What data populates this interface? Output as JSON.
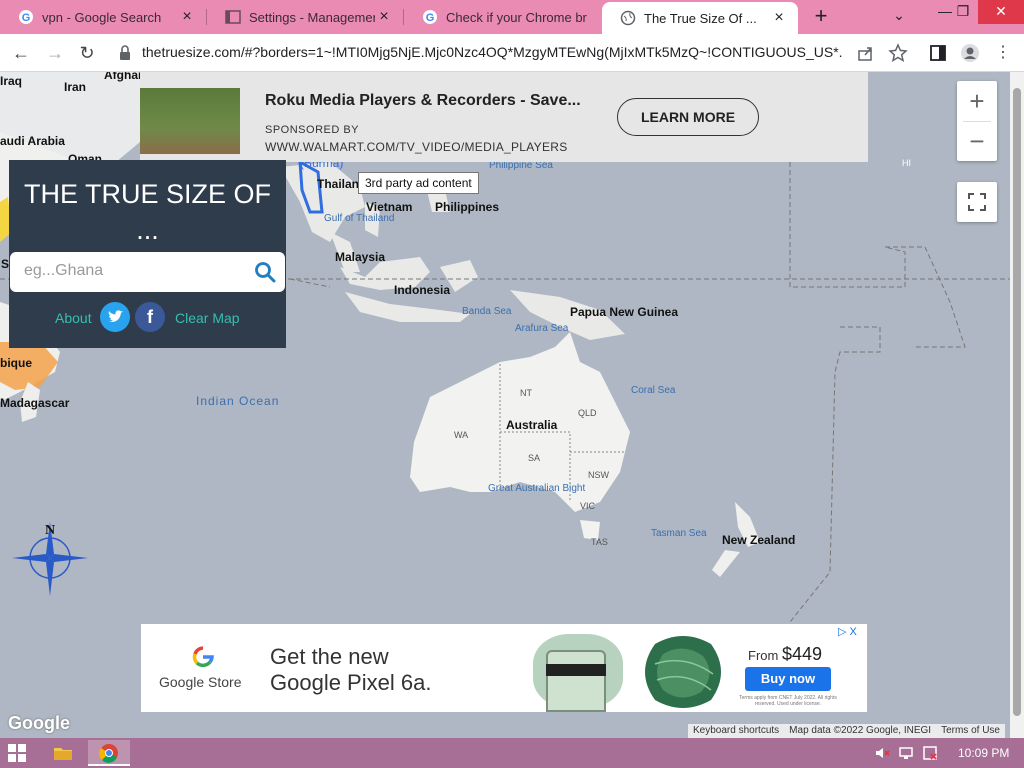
{
  "browser": {
    "tabs": [
      {
        "title": "vpn - Google Search",
        "icon": "google-icon",
        "active": false
      },
      {
        "title": "Settings - Management",
        "icon": "settings-page-icon",
        "active": false
      },
      {
        "title": "Check if your Chrome br",
        "icon": "google-icon",
        "active": false
      },
      {
        "title": "The True Size Of ...",
        "icon": "globe-icon",
        "active": true
      }
    ],
    "url": "thetruesize.com/#?borders=1~!MTI0Mjg5NjE.Mjc0Nzc4OQ*MzgyMTEwNg(MjIxMTk5MzQ~!CONTIGUOUS_US*...",
    "tab_strip_color": "#ea8bb3"
  },
  "top_ad": {
    "headline": "Roku Media Players & Recorders - Save...",
    "sponsored_by": "SPONSORED BY",
    "domain": "WWW.WALMART.COM/TV_VIDEO/MEDIA_PLAYERS",
    "cta": "LEARN MORE"
  },
  "tooltip": "3rd party ad content",
  "panel": {
    "title": "THE TRUE SIZE OF ...",
    "search_placeholder": "eg...Ghana",
    "about": "About",
    "twitter": "twitter-icon",
    "facebook": "f",
    "clear": "Clear Map",
    "bg_color": "#2f3c4c",
    "link_color": "#35bfb0"
  },
  "map": {
    "labels": {
      "iraq": "Iraq",
      "iran": "Iran",
      "afghan": "Afghar",
      "saudi": "audi Arabia",
      "oman": "Oman",
      "thailand": "Thailan",
      "burma": "(Burma)",
      "gulf_thailand": "Gulf of Thailand",
      "vietnam": "Vietnam",
      "philippines": "Philippines",
      "philippine_sea": "Philippine Sea",
      "malaysia": "Malaysia",
      "indonesia": "Indonesia",
      "banda_sea": "Banda Sea",
      "arafura_sea": "Arafura Sea",
      "png": "Papua New Guinea",
      "coral_sea": "Coral Sea",
      "indian_ocean": "Indian Ocean",
      "australia": "Australia",
      "wa": "WA",
      "nt": "NT",
      "qld": "QLD",
      "sa": "SA",
      "nsw": "NSW",
      "vic": "VIC",
      "tas": "TAS",
      "gab": "Great Australian Bight",
      "tasman_sea": "Tasman Sea",
      "new_zealand": "New Zealand",
      "mozambique": "bique",
      "madagascar": "Madagascar",
      "hi": "HI",
      "so": "So"
    },
    "zoom_in": "+",
    "zoom_out": "−",
    "compass_letter": "N",
    "watermark": "Google",
    "attribution": [
      "Keyboard shortcuts",
      "Map data ©2022 Google, INEGI",
      "Terms of Use"
    ]
  },
  "bottom_ad": {
    "store": "Google Store",
    "headline_1": "Get the new",
    "headline_2": "Google Pixel 6a.",
    "price_prefix": "From",
    "price": "$449",
    "cta": "Buy now",
    "fine_print": "Terms apply from CNET July 2022. All rights reserved. Used under license.",
    "ad_choices": "▷ X"
  },
  "taskbar": {
    "time": "10:09 PM"
  }
}
